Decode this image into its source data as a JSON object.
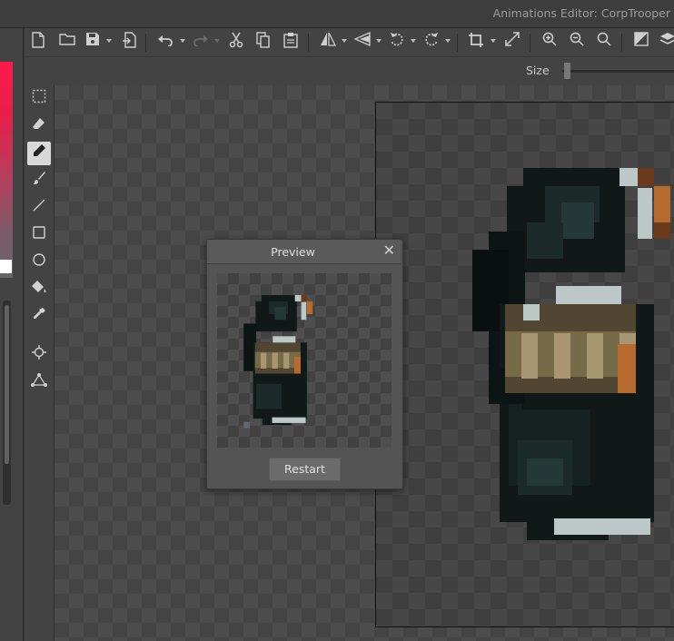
{
  "window": {
    "title": "Animations Editor: CorpTrooper"
  },
  "toolbar": {
    "buttons": [
      {
        "name": "new-file-icon",
        "glyph": "🗋"
      },
      {
        "name": "open-folder-icon",
        "glyph": "🗀"
      },
      {
        "name": "save-icon",
        "glyph": "💾"
      },
      {
        "name": "export-icon",
        "glyph": "⎘"
      },
      {
        "name": "undo-icon",
        "glyph": "↶"
      },
      {
        "name": "redo-icon",
        "glyph": "↷"
      },
      {
        "name": "cut-icon",
        "glyph": "✂"
      },
      {
        "name": "copy-icon",
        "glyph": "❐"
      },
      {
        "name": "paste-icon",
        "glyph": "📋"
      },
      {
        "name": "flip-horizontal-icon",
        "glyph": "◭"
      },
      {
        "name": "flip-vertical-icon",
        "glyph": "◮"
      },
      {
        "name": "rotate-left-icon",
        "glyph": "⟲"
      },
      {
        "name": "rotate-right-icon",
        "glyph": "⟳"
      },
      {
        "name": "crop-icon",
        "glyph": "⌗"
      },
      {
        "name": "resize-icon",
        "glyph": "⤢"
      },
      {
        "name": "zoom-in-icon",
        "glyph": "⊕"
      },
      {
        "name": "zoom-out-icon",
        "glyph": "⊖"
      },
      {
        "name": "zoom-fit-icon",
        "glyph": "⌕"
      },
      {
        "name": "color-swap-icon",
        "glyph": "◩"
      },
      {
        "name": "layers-icon",
        "glyph": "◈"
      }
    ]
  },
  "subbar": {
    "size_label": "Size",
    "size_value": 0.02
  },
  "tools": [
    {
      "name": "select-rect-icon",
      "glyph": "⬚",
      "active": false
    },
    {
      "name": "eraser-icon",
      "glyph": "⌫",
      "active": false
    },
    {
      "name": "pencil-icon",
      "glyph": "✎",
      "active": true
    },
    {
      "name": "brush-icon",
      "glyph": "🖌",
      "active": false
    },
    {
      "name": "line-icon",
      "glyph": "╱",
      "active": false
    },
    {
      "name": "rectangle-icon",
      "glyph": "□",
      "active": false
    },
    {
      "name": "ellipse-icon",
      "glyph": "○",
      "active": false
    },
    {
      "name": "fill-bucket-icon",
      "glyph": "⛾",
      "active": false
    },
    {
      "name": "eyedropper-icon",
      "glyph": "✐",
      "active": false
    },
    {
      "name": "pivot-icon",
      "glyph": "⌖",
      "active": false
    },
    {
      "name": "bone-icon",
      "glyph": "⟁",
      "active": false
    }
  ],
  "preview": {
    "title": "Preview",
    "close_glyph": "✕",
    "restart_label": "Restart"
  },
  "colors": {
    "sprite_dark": "#101818",
    "sprite_mid": "#1c2a2a",
    "sprite_teal": "#243838",
    "sprite_light": "#bcc8c8",
    "sprite_khaki": "#504631",
    "sprite_tan": "#776a49",
    "sprite_bright": "#a79671",
    "sprite_orange": "#b66a2e",
    "sprite_brown": "#6b3a1d"
  }
}
